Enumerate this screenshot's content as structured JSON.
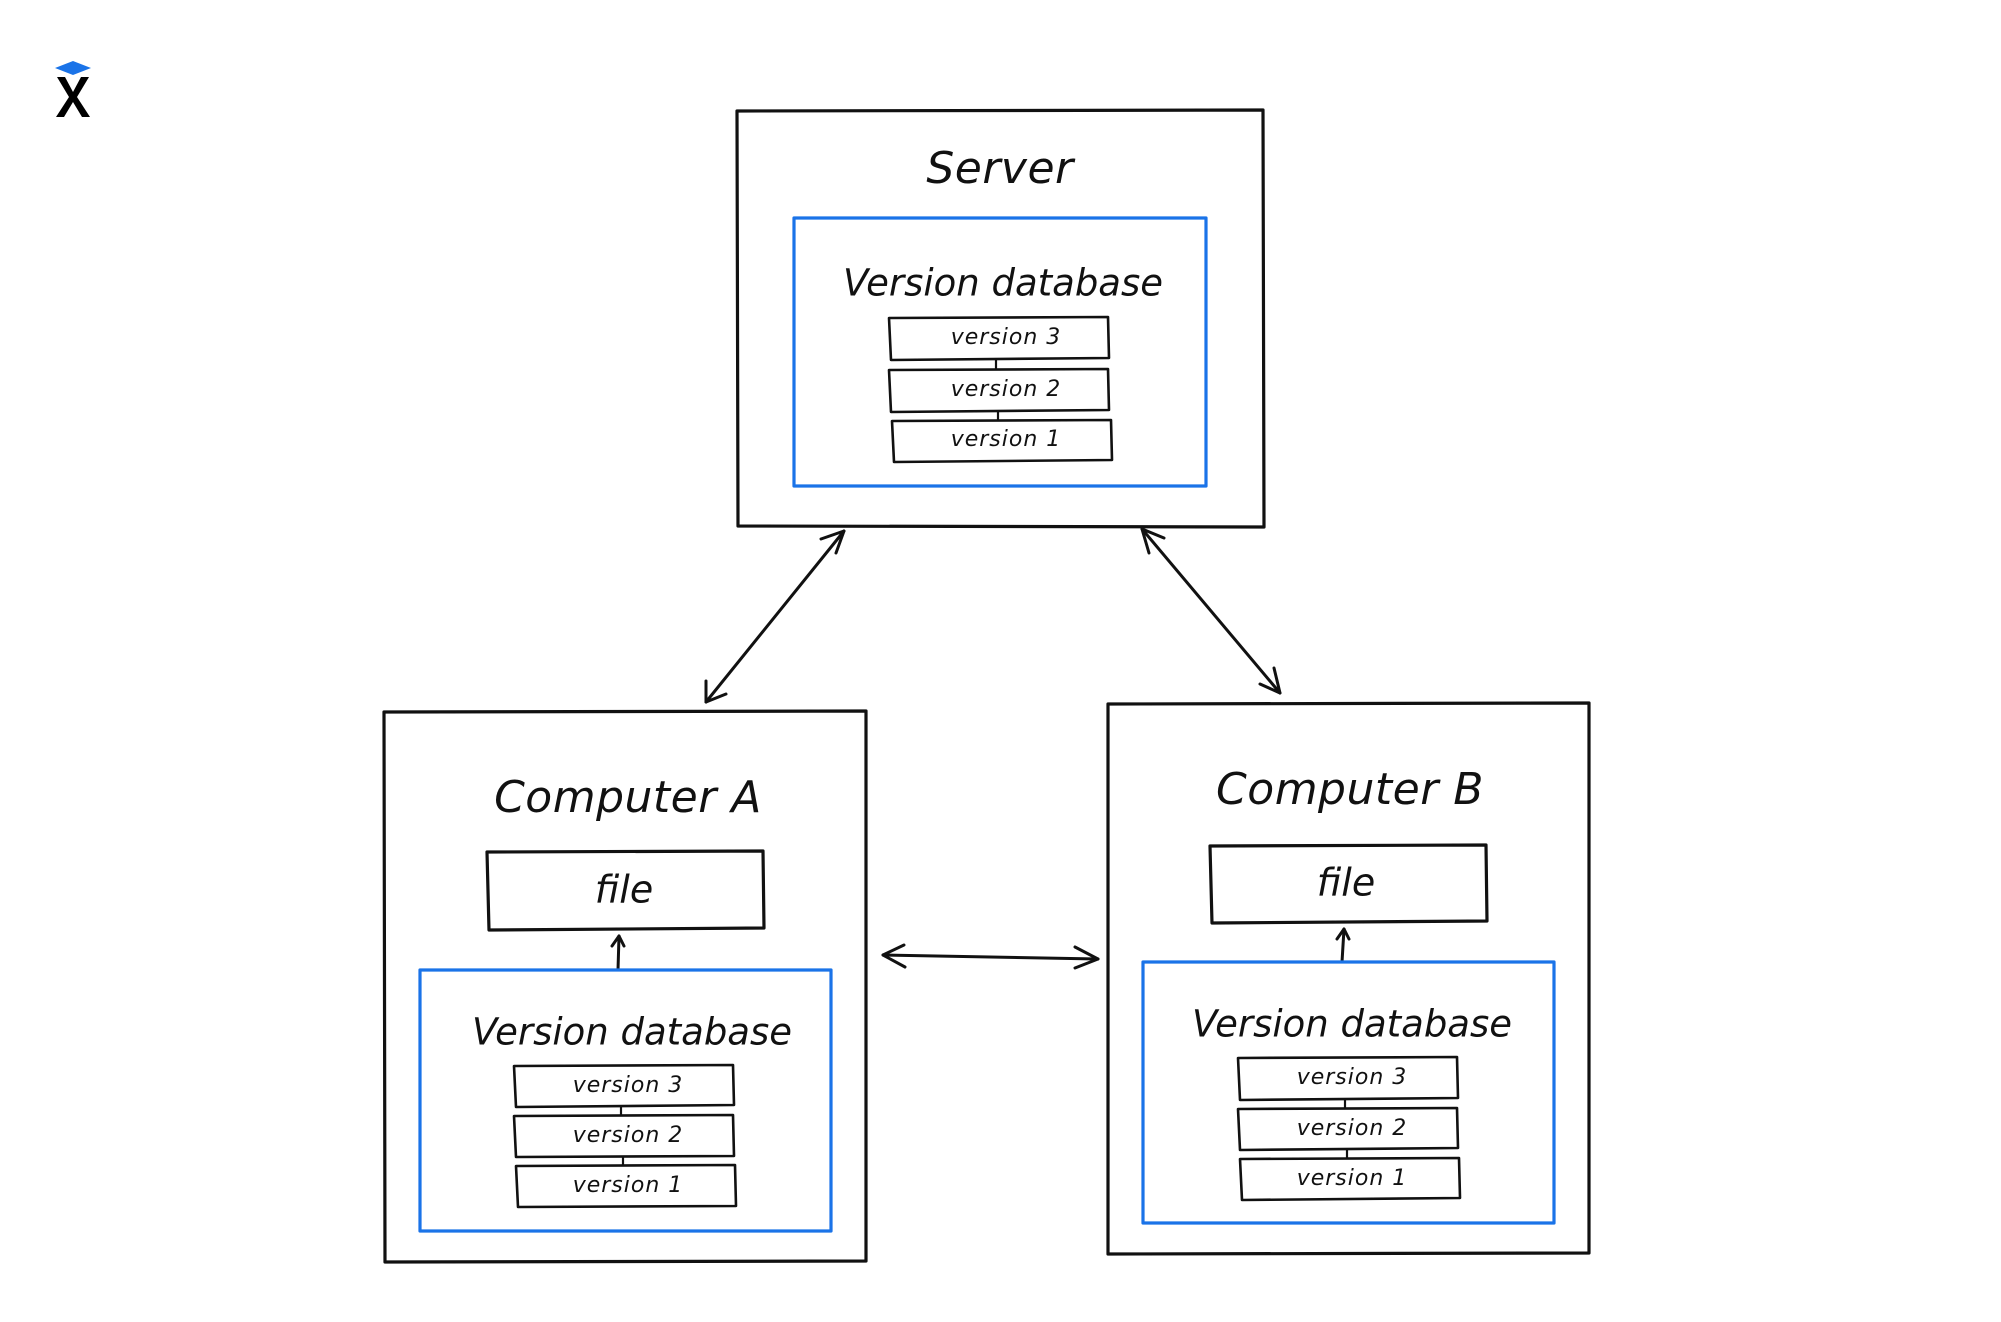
{
  "logo": {
    "name": "logo",
    "colors": {
      "cap": "#1a73e8",
      "mark": "#000000"
    }
  },
  "colors": {
    "accent": "#1a73e8",
    "stroke": "#111111",
    "background": "#ffffff"
  },
  "nodes": {
    "server": {
      "title": "Server",
      "database": {
        "title": "Version database",
        "versions": [
          "version 3",
          "version 2",
          "version 1"
        ]
      }
    },
    "computer_a": {
      "title": "Computer A",
      "file_label": "file",
      "database": {
        "title": "Version database",
        "versions": [
          "version 3",
          "version 2",
          "version 1"
        ]
      }
    },
    "computer_b": {
      "title": "Computer B",
      "file_label": "file",
      "database": {
        "title": "Version database",
        "versions": [
          "version 3",
          "version 2",
          "version 1"
        ]
      }
    }
  },
  "edges": [
    {
      "from": "server",
      "to": "computer_a",
      "direction": "bidirectional"
    },
    {
      "from": "server",
      "to": "computer_b",
      "direction": "bidirectional"
    },
    {
      "from": "computer_a",
      "to": "computer_b",
      "direction": "bidirectional"
    },
    {
      "from": "computer_a.database",
      "to": "computer_a.file",
      "direction": "one-way"
    },
    {
      "from": "computer_b.database",
      "to": "computer_b.file",
      "direction": "one-way"
    }
  ]
}
